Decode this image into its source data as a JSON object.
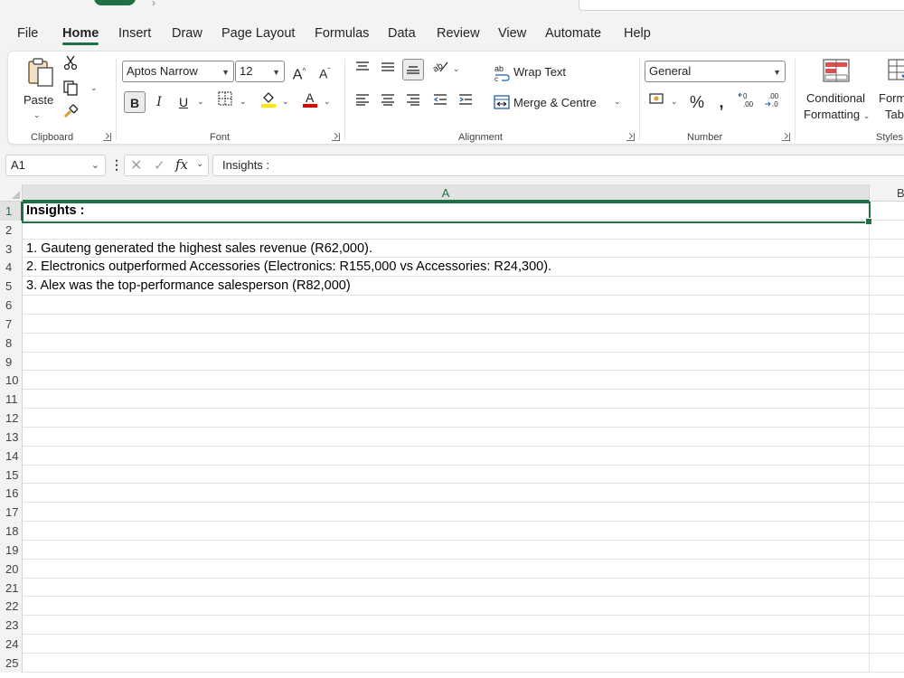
{
  "menu": {
    "tabs": [
      {
        "label": "File"
      },
      {
        "label": "Home"
      },
      {
        "label": "Insert"
      },
      {
        "label": "Draw"
      },
      {
        "label": "Page Layout"
      },
      {
        "label": "Formulas"
      },
      {
        "label": "Data"
      },
      {
        "label": "Review"
      },
      {
        "label": "View"
      },
      {
        "label": "Automate"
      },
      {
        "label": "Help"
      }
    ],
    "active": "Home"
  },
  "ribbon": {
    "clipboard": {
      "paste_label": "Paste",
      "group_label": "Clipboard"
    },
    "font": {
      "family": "Aptos Narrow",
      "size": "12",
      "bold": "B",
      "italic": "I",
      "underline": "U",
      "group_label": "Font"
    },
    "alignment": {
      "wrap_text": "Wrap Text",
      "merge_centre": "Merge & Centre",
      "group_label": "Alignment"
    },
    "number": {
      "format": "General",
      "percent": "%",
      "comma": "౯",
      "group_label": "Number"
    },
    "styles": {
      "conditional_line1": "Conditional",
      "conditional_line2": "Formatting",
      "format_table_line1": "Form",
      "format_table_line2": "Tabl",
      "group_label": "Styles"
    }
  },
  "formula_bar": {
    "name_box": "A1",
    "value": "Insights :"
  },
  "grid": {
    "columns": [
      "A",
      "B"
    ],
    "rows": [
      "1",
      "2",
      "3",
      "4",
      "5",
      "6",
      "7",
      "8",
      "9",
      "10",
      "11",
      "12",
      "13",
      "14",
      "15",
      "16",
      "17",
      "18",
      "19",
      "20",
      "21",
      "22",
      "23",
      "24",
      "25"
    ],
    "cells": {
      "A1": "Insights :",
      "A3": "1. Gauteng generated the highest sales revenue (R62,000).",
      "A4": "2. Electronics outperformed Accessories (Electronics: R155,000 vs Accessories: R24,300).",
      "A5": "3. Alex was the top-performance salesperson (R82,000)"
    }
  },
  "colors": {
    "accent": "#1e7145",
    "ribbon_bg": "#f3f3f3",
    "grid_line": "#e1e1e1"
  }
}
